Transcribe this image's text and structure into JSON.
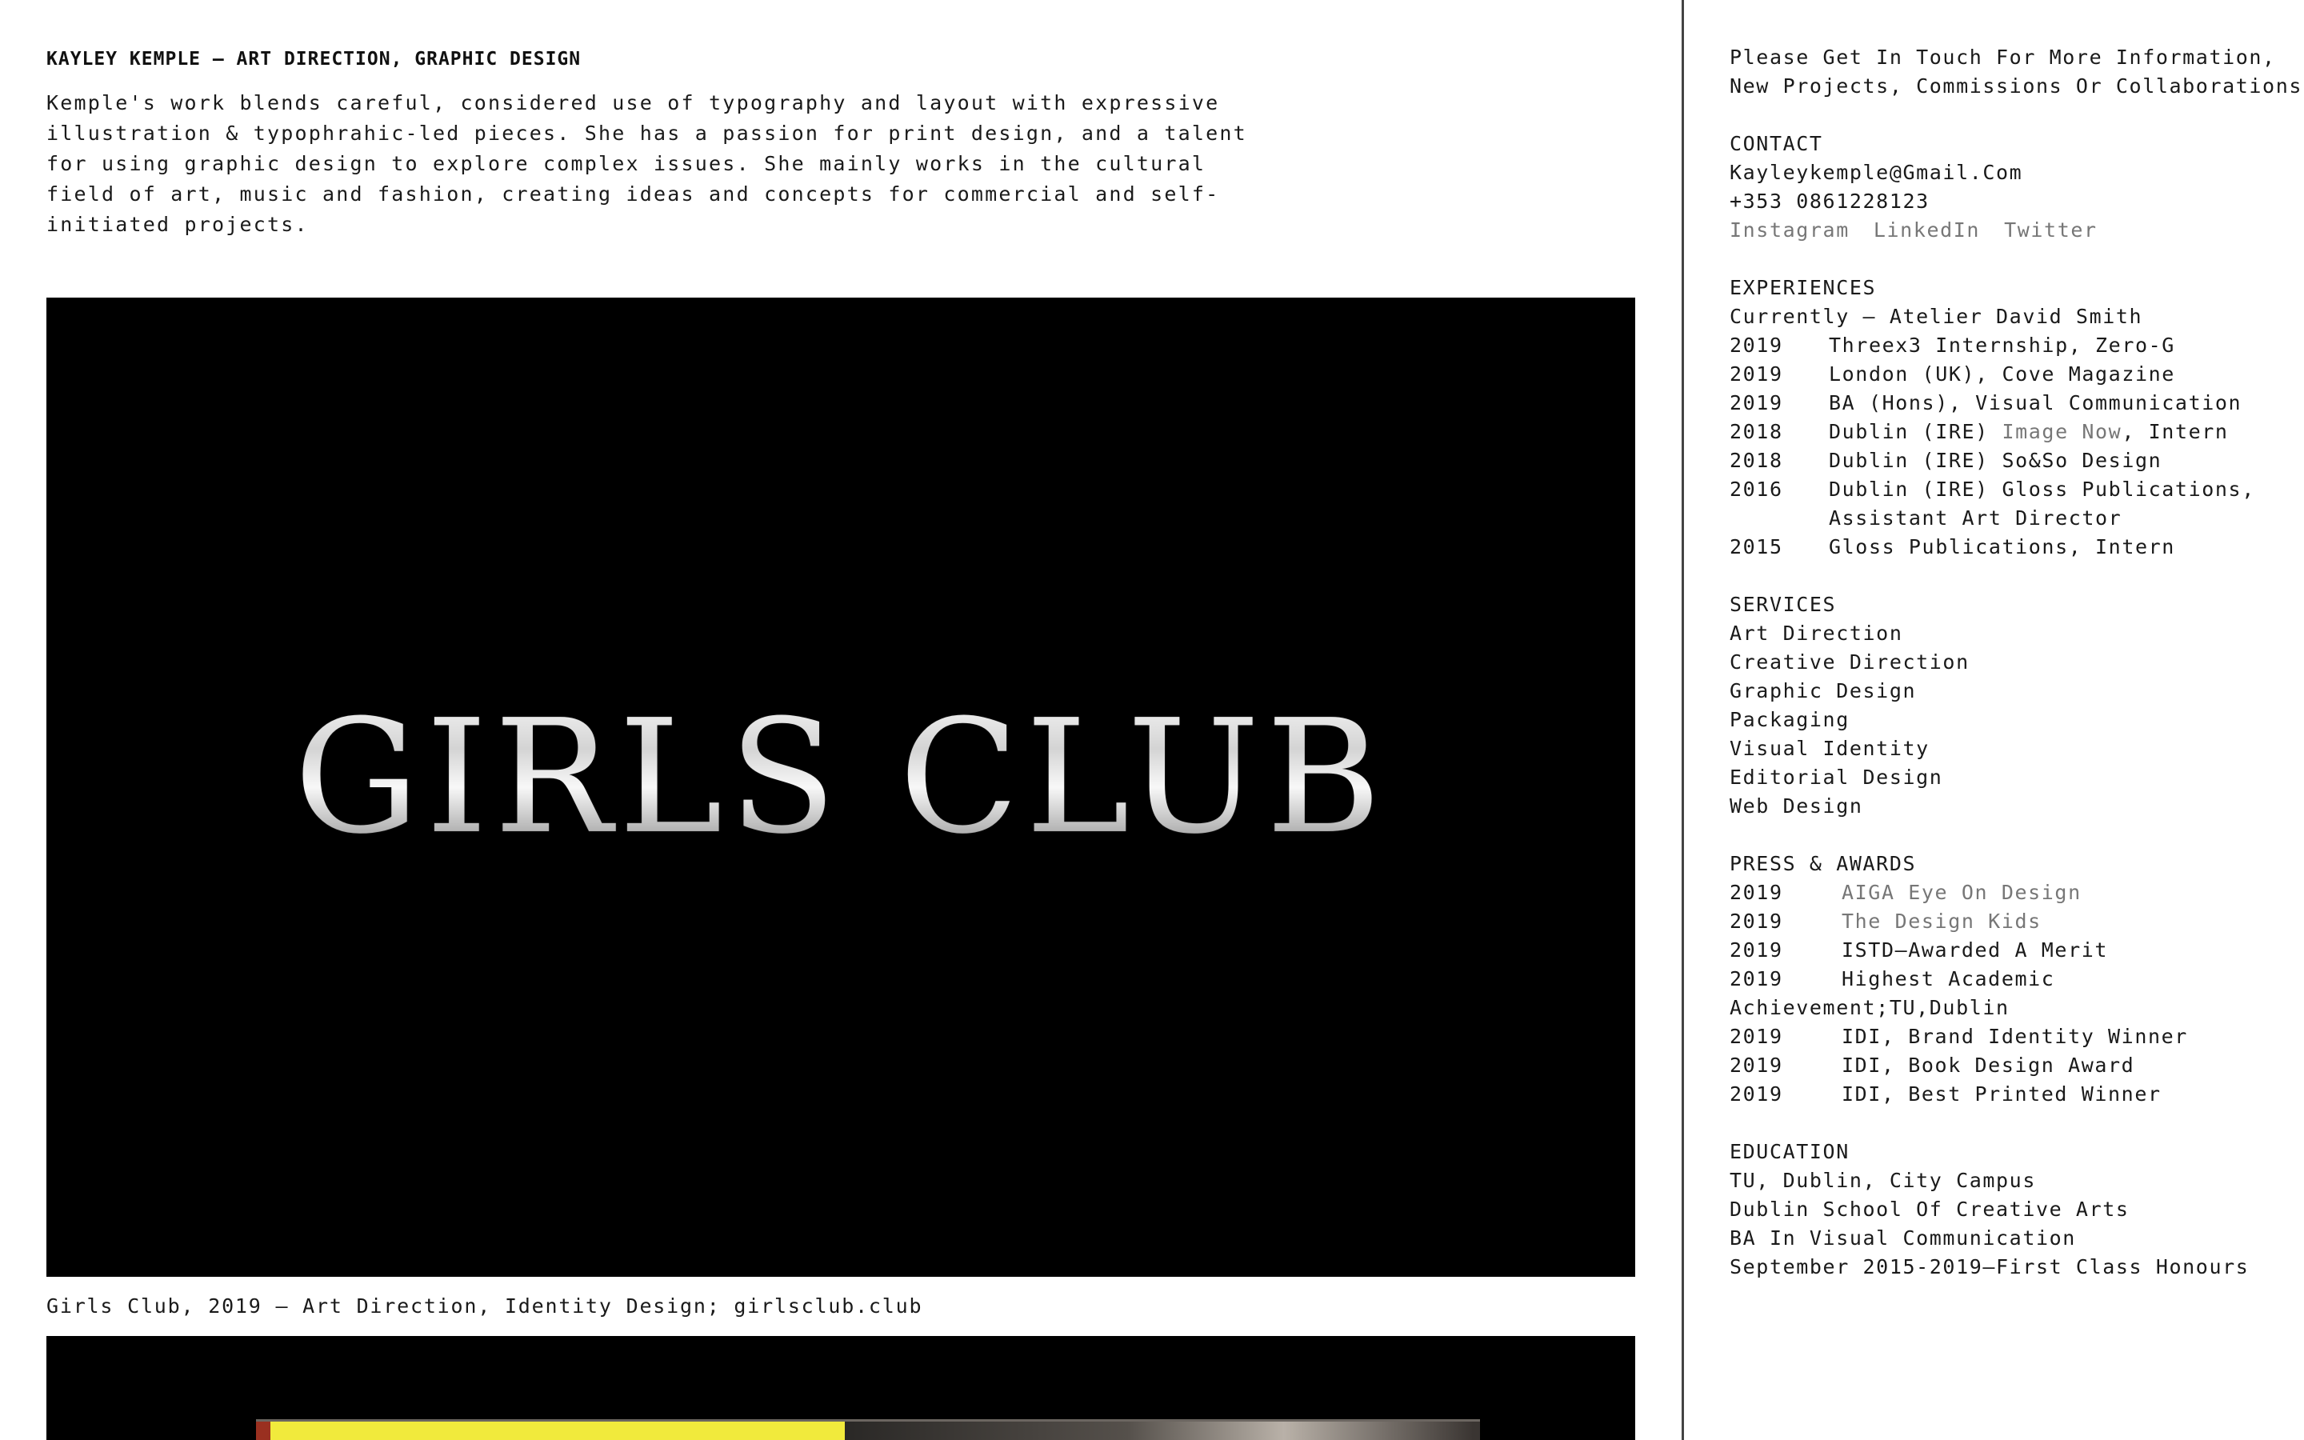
{
  "main": {
    "heading": "KAYLEY KEMPLE — ART DIRECTION, GRAPHIC DESIGN",
    "intro_lines": [
      "Kemple's work blends careful, considered use of typography and layout with expressive",
      "illustration & typophrahic-led pieces. She has a passion for print design, and a talent",
      "for using graphic design to explore complex issues. She mainly works in the cultural",
      "field of art, music and fashion, creating ideas and concepts for commercial and self-",
      "initiated projects."
    ],
    "project1": {
      "image_title": "GIRLS CLUB",
      "caption": "Girls Club, 2019 — Art Direction, Identity Design; girlsclub.club"
    }
  },
  "sidebar": {
    "intro_lines": [
      "Please Get In Touch For More Information,",
      "New Projects, Commissions Or Collaborations."
    ],
    "contact": {
      "title": "CONTACT",
      "email": "Kayleykemple@Gmail.Com",
      "phone": "+353 0861228123",
      "social": [
        "Instagram",
        "LinkedIn",
        "Twitter"
      ]
    },
    "experiences": {
      "title": "EXPERIENCES",
      "current": "Currently — Atelier David Smith",
      "items": [
        {
          "year": "2019",
          "text": "Threex3 Internship, Zero-G"
        },
        {
          "year": "2019",
          "text": "London (UK), Cove Magazine"
        },
        {
          "year": "2019",
          "text": "BA (Hons), Visual Communication"
        },
        {
          "year": "2018",
          "pre": "Dublin (IRE) ",
          "link": "Image Now",
          "post": ", Intern"
        },
        {
          "year": "2018",
          "text": "Dublin (IRE) So&So Design"
        },
        {
          "year": "2016",
          "text": "Dublin (IRE) Gloss Publications,",
          "text2": "Assistant Art Director"
        },
        {
          "year": "2015",
          "text": "Gloss Publications, Intern"
        }
      ]
    },
    "services": {
      "title": "SERVICES",
      "items": [
        "Art Direction",
        "Creative Direction",
        "Graphic Design",
        "Packaging",
        "Visual Identity",
        "Editorial Design",
        "Web Design"
      ]
    },
    "press": {
      "title": "PRESS & AWARDS",
      "items": [
        {
          "year": "2019",
          "text": "AIGA Eye On Design",
          "link": true
        },
        {
          "year": "2019",
          "text": "The Design Kids",
          "link": true
        },
        {
          "year": "2019",
          "text": "ISTD—Awarded A Merit"
        },
        {
          "year": "2019",
          "text": "Highest Academic"
        },
        {
          "wrap": "Achievement;TU,Dublin"
        },
        {
          "year": "2019",
          "text": "IDI, Brand Identity Winner"
        },
        {
          "year": "2019",
          "text": "IDI, Book Design Award"
        },
        {
          "year": "2019",
          "text": "IDI, Best Printed Winner"
        }
      ]
    },
    "education": {
      "title": "EDUCATION",
      "items": [
        "TU, Dublin, City Campus",
        "Dublin School Of Creative Arts",
        "BA In Visual Communication",
        "September 2015-2019—First Class Honours"
      ]
    }
  }
}
